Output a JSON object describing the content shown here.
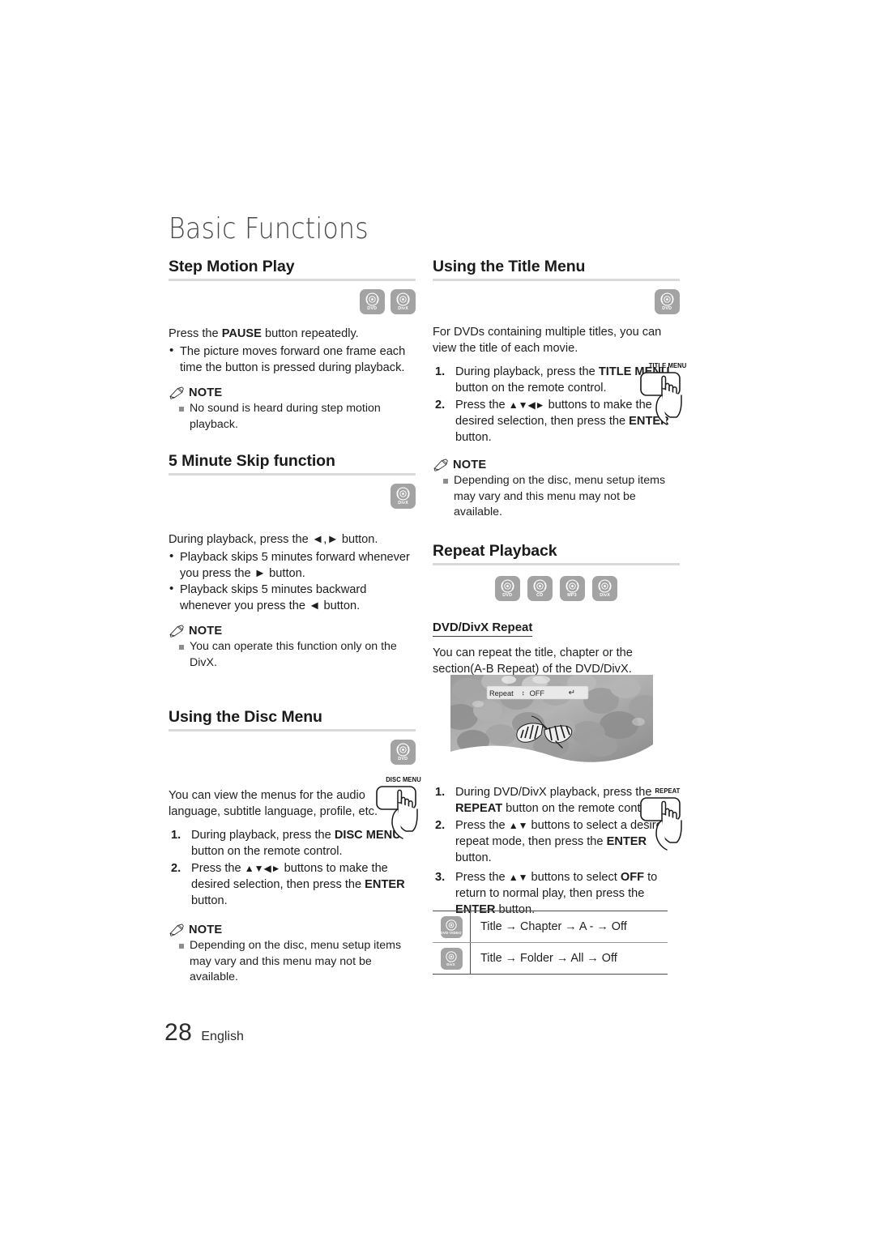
{
  "page": {
    "chapter_title": "Basic Functions",
    "page_number": "28",
    "language": "English"
  },
  "media_badges": {
    "dvd": "DVD",
    "divx": "DivX",
    "cd": "CD",
    "mp3": "MP3",
    "dvd_video": "DVD-VIDEO"
  },
  "note_label": "NOTE",
  "left_column": {
    "step_motion": {
      "heading": "Step Motion Play",
      "badges": [
        "DVD",
        "DivX"
      ],
      "intro_prefix": "Press the ",
      "intro_bold": "PAUSE",
      "intro_suffix": " button repeatedly.",
      "bullets": [
        "The picture moves forward one frame each time the button is pressed during playback."
      ],
      "notes": [
        "No sound is heard during step motion playback."
      ]
    },
    "five_minute_skip": {
      "heading": "5 Minute Skip function",
      "badges": [
        "DivX"
      ],
      "intro": "During playback, press the ◄,► button.",
      "bullets": [
        "Playback skips 5 minutes forward whenever you press the ► button.",
        "Playback skips 5 minutes backward whenever you press the ◄ button."
      ],
      "notes": [
        "You can operate this function only on the DivX."
      ]
    },
    "disc_menu": {
      "heading": "Using the Disc Menu",
      "badges": [
        "DVD"
      ],
      "intro": "You can view the menus for the audio language, subtitle language, profile, etc.",
      "steps": [
        {
          "num": "1.",
          "parts": [
            {
              "t": "During playback, press the ",
              "b": false
            },
            {
              "t": "DISC MENU",
              "b": true
            },
            {
              "t": " button on the remote control.",
              "b": false
            }
          ]
        },
        {
          "num": "2.",
          "parts": [
            {
              "t": "Press the ▲▼◄► buttons to make the desired selection, then press the ",
              "b": false
            },
            {
              "t": "ENTER",
              "b": true
            },
            {
              "t": " button.",
              "b": false
            }
          ]
        }
      ],
      "remote_label": "DISC MENU",
      "notes": [
        "Depending on the disc, menu setup items may vary and this menu may not be available."
      ]
    }
  },
  "right_column": {
    "title_menu": {
      "heading": "Using the Title Menu",
      "badges": [
        "DVD"
      ],
      "intro": "For DVDs containing multiple titles, you can view the title of each movie.",
      "steps": [
        {
          "num": "1.",
          "parts": [
            {
              "t": "During playback, press the ",
              "b": false
            },
            {
              "t": "TITLE MENU",
              "b": true
            },
            {
              "t": " button on the remote control.",
              "b": false
            }
          ]
        },
        {
          "num": "2.",
          "parts": [
            {
              "t": "Press the ▲▼◄► buttons to make the desired selection, then press the ",
              "b": false
            },
            {
              "t": "ENTER",
              "b": true
            },
            {
              "t": " button.",
              "b": false
            }
          ]
        }
      ],
      "remote_label": "TITLE MENU",
      "notes": [
        "Depending on the disc, menu setup items may vary and this menu may not be available."
      ]
    },
    "repeat_playback": {
      "heading": "Repeat Playback",
      "badges": [
        "DVD",
        "CD",
        "MP3",
        "DivX"
      ],
      "subheading": "DVD/DivX Repeat",
      "intro": "You can repeat the title, chapter or the section(A-B Repeat) of the DVD/DivX.",
      "osd": {
        "label": "Repeat",
        "updown_icon": "up-down-arrow-icon",
        "value": "OFF",
        "return_icon": "return-icon"
      },
      "steps": [
        {
          "num": "1.",
          "parts": [
            {
              "t": "During DVD/DivX playback, press the ",
              "b": false
            },
            {
              "t": "REPEAT",
              "b": true
            },
            {
              "t": " button on the remote control.",
              "b": false
            }
          ]
        },
        {
          "num": "2.",
          "parts": [
            {
              "t": "Press the ▲▼ buttons to select a desired repeat mode, then press the ",
              "b": false
            },
            {
              "t": "ENTER",
              "b": true
            },
            {
              "t": " button.",
              "b": false
            }
          ]
        },
        {
          "num": "3.",
          "parts": [
            {
              "t": "Press the ▲▼ buttons to select ",
              "b": false
            },
            {
              "t": "OFF",
              "b": true
            },
            {
              "t": " to return to normal play, then press the ",
              "b": false
            },
            {
              "t": "ENTER",
              "b": true
            },
            {
              "t": " button.",
              "b": false
            }
          ]
        }
      ],
      "remote_label": "REPEAT",
      "mode_table": [
        {
          "icon": "DVD-VIDEO",
          "modes": "Title → Chapter → A - → Off"
        },
        {
          "icon": "DivX",
          "modes": "Title → Folder → All → Off"
        }
      ]
    }
  },
  "colors": {
    "badge_bg": "#a3a3a3",
    "rule": "#d9d9d9",
    "note_square": "#8d8d8d",
    "text": "#1f1f1f"
  }
}
